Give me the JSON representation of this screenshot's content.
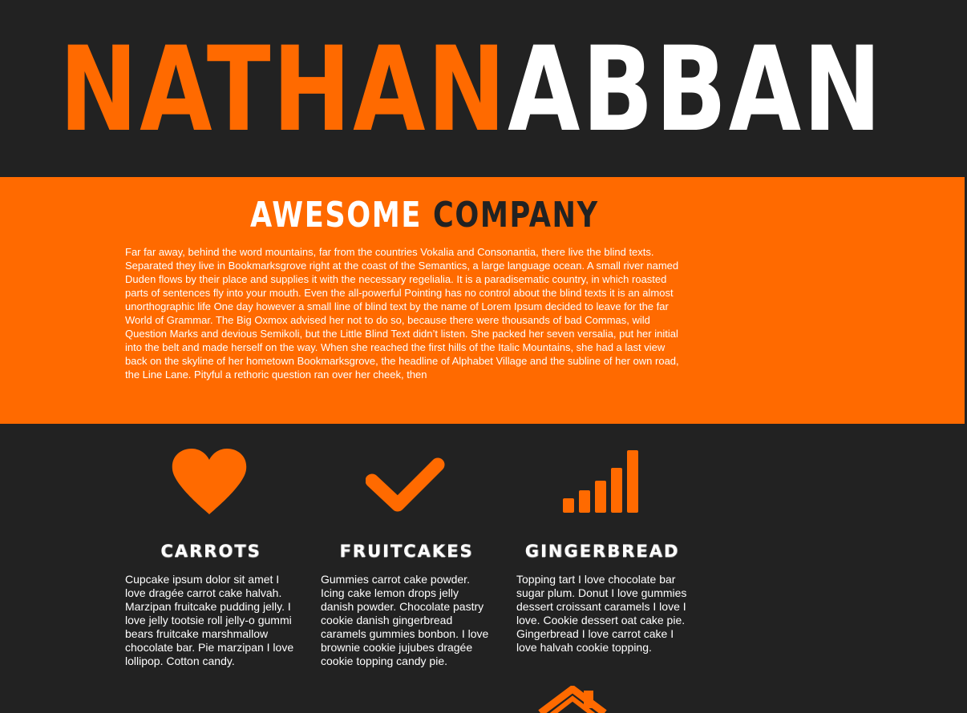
{
  "header": {
    "first_name": "NATHAN",
    "last_name": "ABBAN"
  },
  "about": {
    "title_part1": "AWESOME ",
    "title_part2": "COMPANY",
    "body": "Far far away, behind the word mountains, far from the countries Vokalia and Consonantia, there live the blind texts. Separated they live in Bookmarksgrove right at the coast of the Semantics, a large language ocean. A small river named Duden flows by their place and supplies it with the necessary regelialia. It is a paradisematic country, in which roasted parts of sentences fly into your mouth. Even the all-powerful Pointing has no control about the blind texts it is an almost unorthographic life One day however a small line of blind text by the name of Lorem Ipsum decided to leave for the far World of Grammar. The Big Oxmox advised her not to do so, because there were thousands of bad Commas, wild Question Marks and devious Semikoli, but the Little Blind Text didn’t listen. She packed her seven versalia, put her initial into the belt and made herself on the way. When she reached the first hills of the Italic Mountains, she had a last view back on the skyline of her hometown Bookmarksgrove, the headline of Alphabet Village and the subline of her own road, the Line Lane. Pityful a rethoric question ran over her cheek, then"
  },
  "features": [
    {
      "icon": "heart-icon",
      "title": "CARROTS",
      "text": "Cupcake ipsum dolor sit amet I love dragée carrot cake halvah. Marzipan fruitcake pudding jelly. I love jelly tootsie roll jelly-o gummi bears fruitcake marshmallow chocolate bar. Pie marzipan I love lollipop. Cotton candy."
    },
    {
      "icon": "checkmark-icon",
      "title": "FRUITCAKES",
      "text": "Gummies carrot cake powder. Icing cake lemon drops jelly danish powder. Chocolate pastry cookie danish gingerbread caramels gummies bonbon. I love brownie cookie jujubes dragée cookie topping candy pie."
    },
    {
      "icon": "signal-bars-icon",
      "title": "GINGERBREAD",
      "text": "Topping tart I love chocolate bar sugar plum. Donut I love gummies dessert croissant caramels I love I love. Cookie dessert oat cake pie. Gingerbread I love carrot cake I love halvah cookie topping."
    }
  ],
  "colors": {
    "accent": "#ff6a00",
    "background": "#222222",
    "text_light": "#ffffff"
  }
}
